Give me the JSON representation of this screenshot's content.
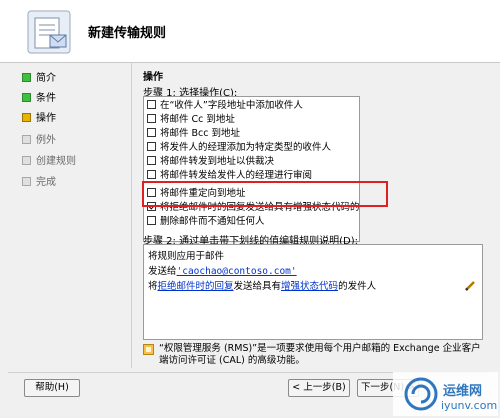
{
  "window": {
    "title": "新建传输规则"
  },
  "nav": {
    "items": [
      {
        "label": "简介",
        "state": "done"
      },
      {
        "label": "条件",
        "state": "done"
      },
      {
        "label": "操作",
        "state": "current"
      },
      {
        "label": "例外",
        "state": "pending"
      },
      {
        "label": "创建规则",
        "state": "pending"
      },
      {
        "label": "完成",
        "state": "pending"
      }
    ]
  },
  "main": {
    "section_title": "操作",
    "step1_label": "步骤 1: 选择操作(C):",
    "actions": [
      {
        "label": "在“收件人”字段地址中添加收件人",
        "checked": false
      },
      {
        "label": "将邮件 Cc 到地址",
        "checked": false
      },
      {
        "label": "将邮件 Bcc 到地址",
        "checked": false
      },
      {
        "label": "将发件人的经理添加为特定类型的收件人",
        "checked": false
      },
      {
        "label": "将邮件转发到地址以供裁决",
        "checked": false
      },
      {
        "label": "将邮件转发给发件人的经理进行审阅",
        "checked": false
      },
      {
        "label": "将邮件重定向到地址",
        "checked": false
      },
      {
        "label": "将拒绝邮件时的回复发送给具有增强状态代码的发件人",
        "checked": true
      },
      {
        "label": "删除邮件而不通知任何人",
        "checked": false
      }
    ],
    "step2_label": "步骤 2: 通过单击带下划线的值编辑规则说明(D):",
    "description": {
      "line1": "将规则应用于邮件",
      "line2_prefix": "发送给",
      "line2_link": "'caochao@contoso.com'",
      "line3_prefix": "将",
      "line3_link1": "拒绝邮件时的回复",
      "line3_middle": "发送给具有",
      "line3_link2": "增强状态代码",
      "line3_suffix": "的发件人"
    },
    "info_text": "“权限管理服务 (RMS)”是一项要求使用每个用户邮箱的 Exchange 企业客户端访问许可证 (CAL) 的高级功能。"
  },
  "footer": {
    "help": "帮助(H)",
    "back": "< 上一步(B)",
    "next": "下一步(N) >"
  },
  "watermark": {
    "text": "运维网",
    "url": "iyunv.com"
  },
  "colors": {
    "highlight": "#e02020",
    "link": "#0033cc",
    "done": "#3fbf3f",
    "current": "#e8b400"
  }
}
